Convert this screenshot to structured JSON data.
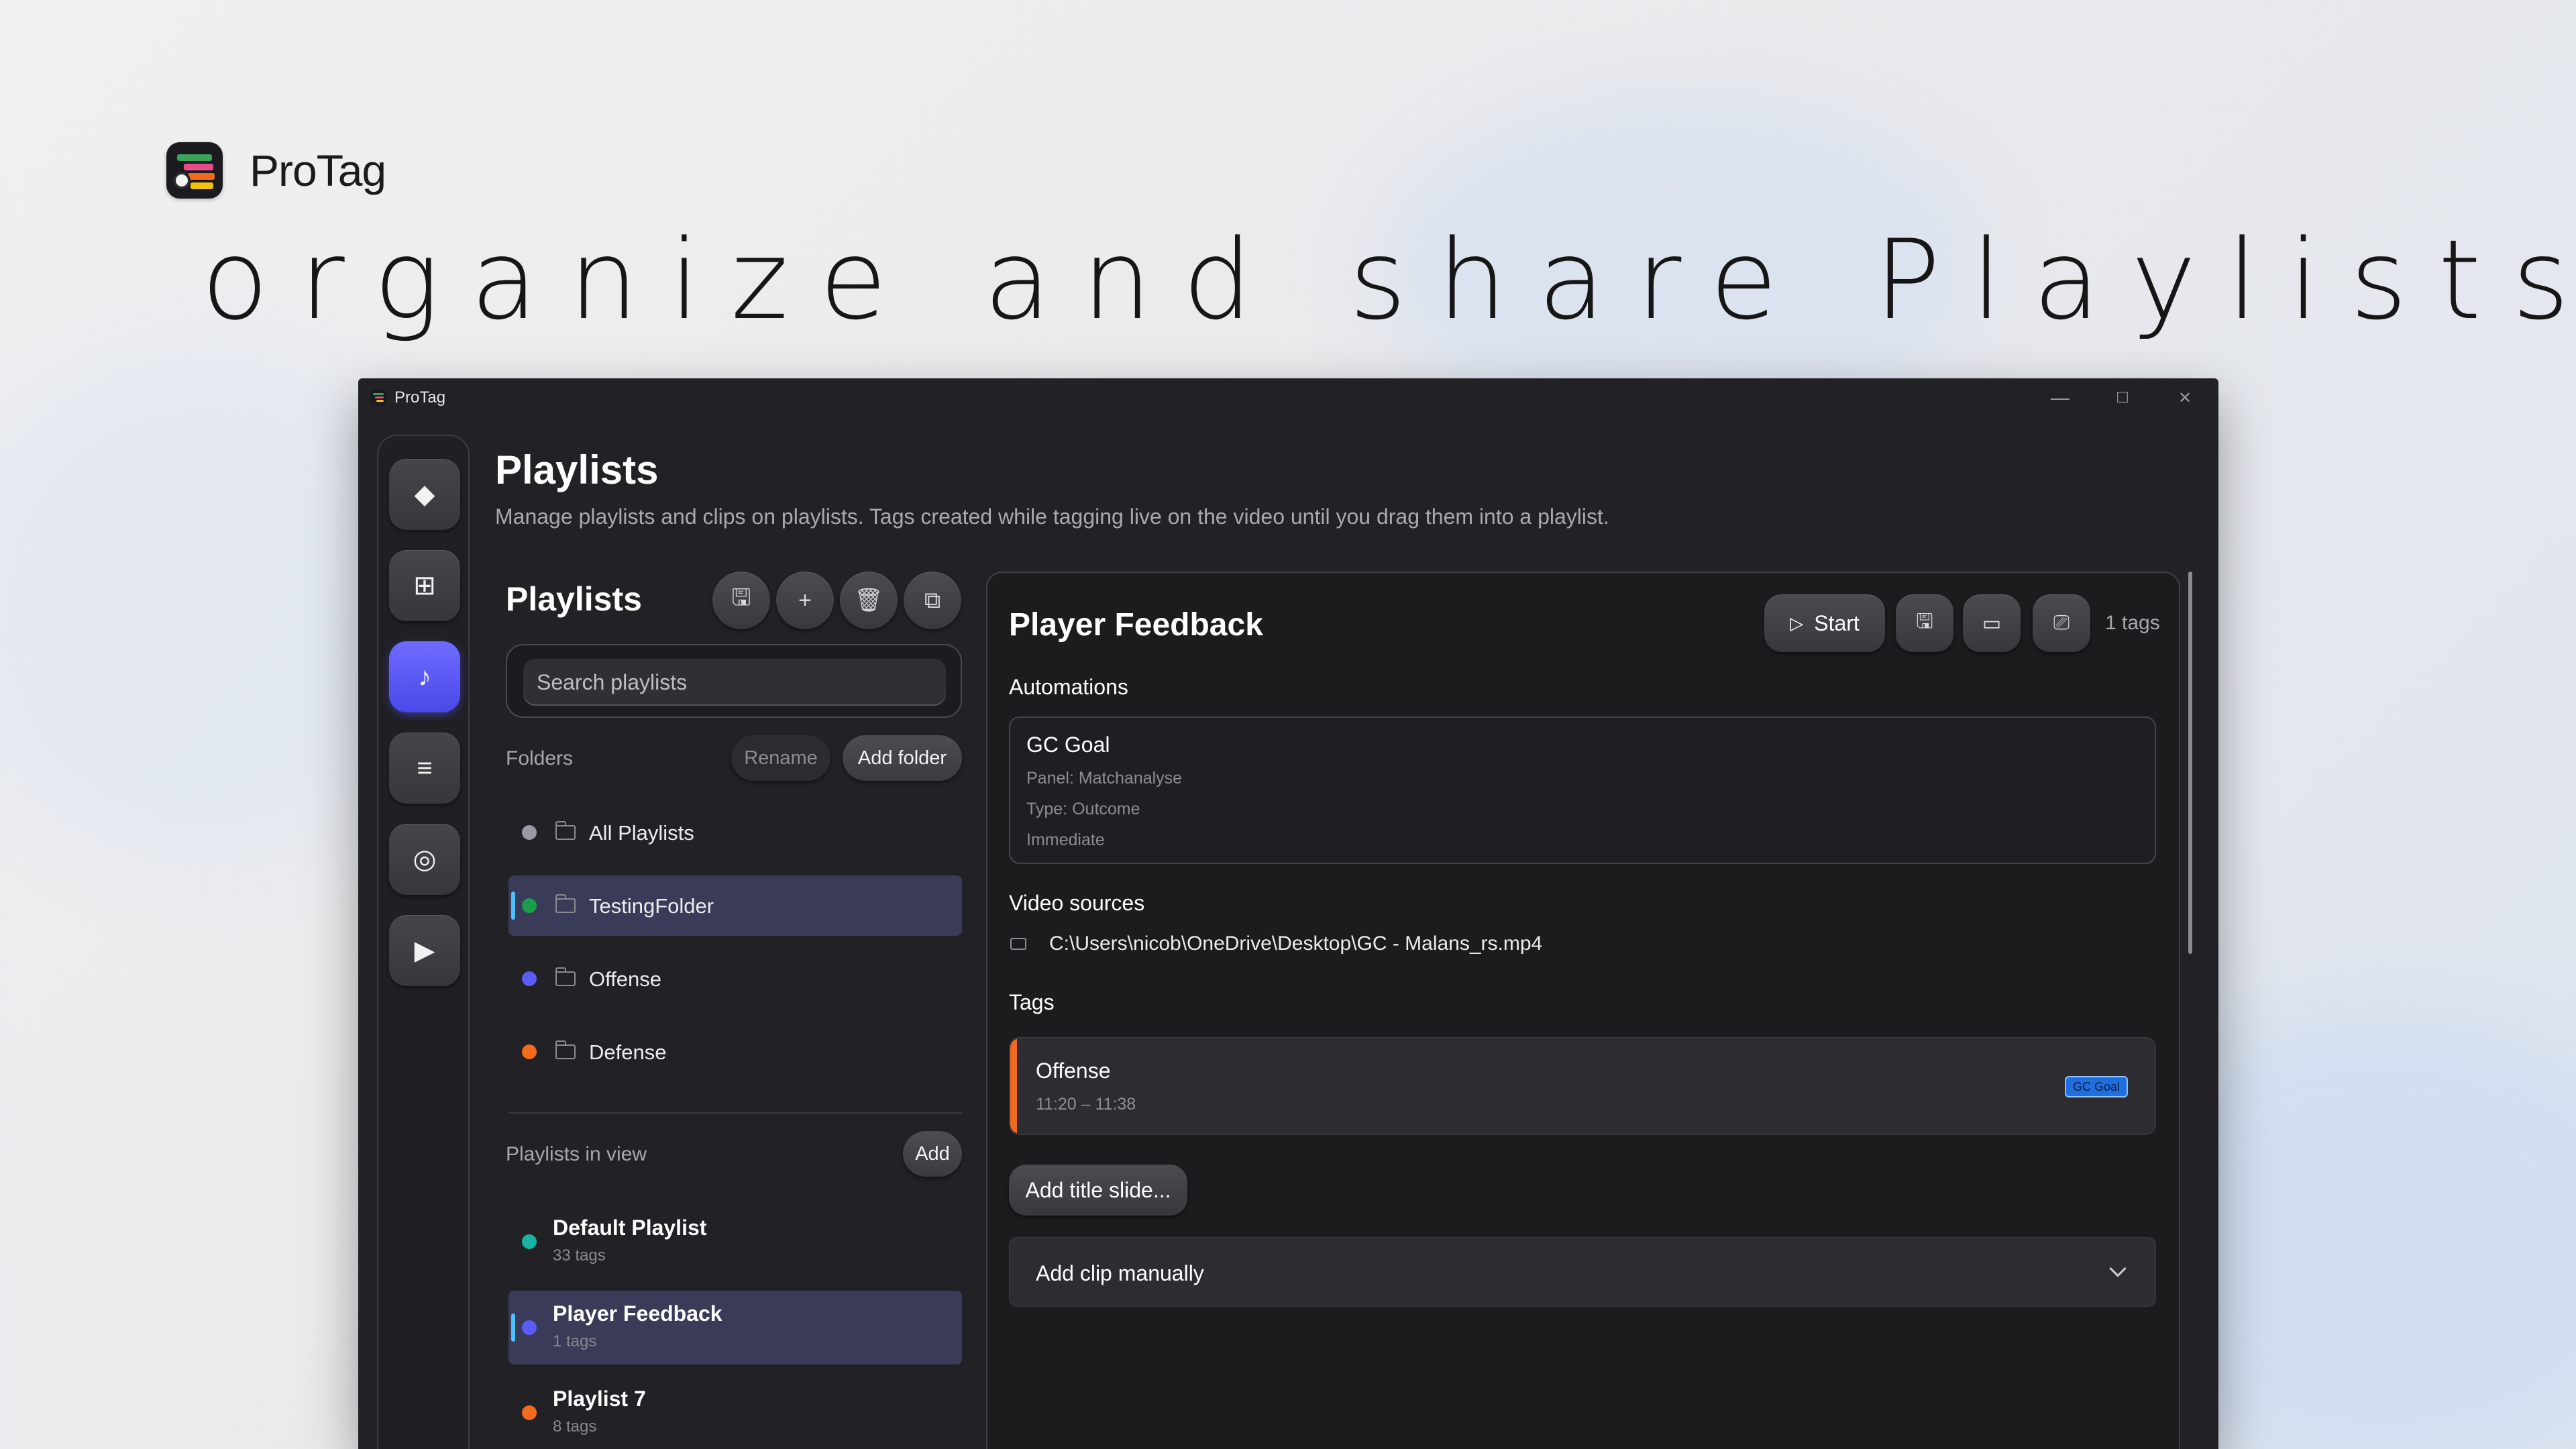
{
  "marketing": {
    "app_name": "ProTag",
    "headline": "organize and share Playlists"
  },
  "window": {
    "title": "ProTag",
    "controls": {
      "minimize": "—",
      "maximize": "☐",
      "close": "✕"
    }
  },
  "rail": {
    "items": [
      {
        "icon": "diamond-icon",
        "glyph": "◆",
        "active": false
      },
      {
        "icon": "grid-icon",
        "glyph": "⊞",
        "active": false
      },
      {
        "icon": "music-note-icon",
        "glyph": "♪",
        "active": true
      },
      {
        "icon": "list-icon",
        "glyph": "≡",
        "active": false
      },
      {
        "icon": "target-icon",
        "glyph": "◎",
        "active": false
      },
      {
        "icon": "play-icon",
        "glyph": "▶",
        "active": false
      }
    ]
  },
  "page": {
    "title": "Playlists",
    "description": "Manage playlists and clips on playlists. Tags created while tagging live on the video until you drag them into a playlist."
  },
  "left_panel": {
    "title": "Playlists",
    "toolbar": [
      {
        "icon": "save-icon",
        "glyph": "🖫"
      },
      {
        "icon": "plus-icon",
        "glyph": "+"
      },
      {
        "icon": "trash-icon",
        "glyph": "🗑"
      },
      {
        "icon": "export-icon",
        "glyph": "⧉"
      }
    ],
    "search_placeholder": "Search playlists",
    "folders_label": "Folders",
    "rename_label": "Rename",
    "add_folder_label": "Add folder",
    "folders": [
      {
        "label": "All Playlists",
        "color": "#9a9aa6",
        "selected": false
      },
      {
        "label": "TestingFolder",
        "color": "#1a9e4a",
        "selected": true
      },
      {
        "label": "Offense",
        "color": "#5b5cf6",
        "selected": false
      },
      {
        "label": "Defense",
        "color": "#f26b1d",
        "selected": false
      }
    ],
    "playlists_label": "Playlists in view",
    "add_label": "Add",
    "playlists": [
      {
        "name": "Default Playlist",
        "count": "33 tags",
        "color": "#19b3a3",
        "selected": false
      },
      {
        "name": "Player Feedback",
        "count": "1 tags",
        "color": "#5b5cf6",
        "selected": true
      },
      {
        "name": "Playlist 7",
        "count": "8 tags",
        "color": "#f26b1d",
        "selected": false
      }
    ]
  },
  "detail": {
    "title": "Player Feedback",
    "start_label": "Start",
    "tag_count": "1 tags",
    "automations_label": "Automations",
    "automation": {
      "name": "GC Goal",
      "panel": "Panel: Matchanalyse",
      "type": "Type: Outcome",
      "timing": "Immediate"
    },
    "video_sources_label": "Video sources",
    "video_path": "C:\\Users\\nicob\\OneDrive\\Desktop\\GC - Malans_rs.mp4",
    "tags_label": "Tags",
    "tag": {
      "name": "Offense",
      "time": "11:20 – 11:38",
      "badge": "GC Goal",
      "accent": "#f26b1d"
    },
    "add_title_slide": "Add title slide...",
    "add_clip_manually": "Add clip manually"
  }
}
